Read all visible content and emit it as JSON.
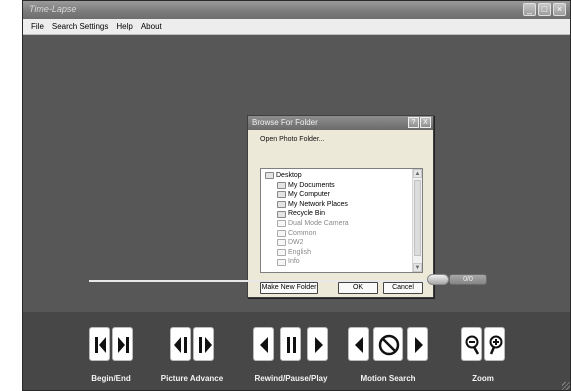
{
  "window": {
    "title": "Time-Lapse"
  },
  "menu": [
    "File",
    "Search Settings",
    "Help",
    "About"
  ],
  "dialog": {
    "title": "Browse For Folder",
    "help_glyph": "?",
    "close_glyph": "X",
    "caption": "Open Photo Folder...",
    "tree": [
      {
        "label": "Desktop",
        "level": 0,
        "dim": false
      },
      {
        "label": "My Documents",
        "level": 1,
        "dim": false
      },
      {
        "label": "My Computer",
        "level": 1,
        "dim": false
      },
      {
        "label": "My Network Places",
        "level": 1,
        "dim": false
      },
      {
        "label": "Recycle Bin",
        "level": 1,
        "dim": false
      },
      {
        "label": "Dual Mode Camera",
        "level": 1,
        "dim": true
      },
      {
        "label": "Common",
        "level": 1,
        "dim": true
      },
      {
        "label": "DW2",
        "level": 1,
        "dim": true
      },
      {
        "label": "English",
        "level": 1,
        "dim": true
      },
      {
        "label": "Info",
        "level": 1,
        "dim": true
      }
    ],
    "buttons": {
      "new_folder": "Make New Folder",
      "ok": "OK",
      "cancel": "Cancel"
    }
  },
  "timeline": {
    "counter": "0/0"
  },
  "controls": {
    "groups": [
      {
        "label": "Begin/End"
      },
      {
        "label": "Picture Advance"
      },
      {
        "label": "Rewind/Pause/Play"
      },
      {
        "label": "Motion Search"
      },
      {
        "label": "Zoom"
      }
    ]
  }
}
